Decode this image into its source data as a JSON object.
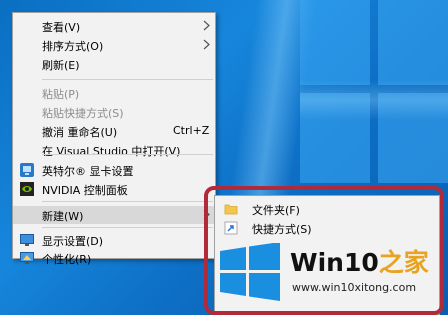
{
  "context_menu": {
    "items": [
      {
        "label": "查看(V)"
      },
      {
        "label": "排序方式(O)"
      },
      {
        "label": "刷新(E)"
      },
      {
        "label": "粘贴(P)"
      },
      {
        "label": "粘贴快捷方式(S)"
      },
      {
        "label": "撤消 重命名(U)",
        "shortcut": "Ctrl+Z"
      },
      {
        "label": "在 Visual Studio 中打开(V)"
      },
      {
        "label": "英特尔® 显卡设置"
      },
      {
        "label": "NVIDIA 控制面板"
      },
      {
        "label": "新建(W)"
      },
      {
        "label": "显示设置(D)"
      },
      {
        "label": "个性化(R)"
      }
    ]
  },
  "submenu": {
    "items": [
      {
        "label": "文件夹(F)"
      },
      {
        "label": "快捷方式(S)"
      }
    ]
  },
  "watermark": {
    "title_main": "Win10",
    "title_accent": "之家",
    "url": "www.win10xitong.com"
  },
  "colors": {
    "desktop": "#1686dc",
    "menu_bg": "#f2f2f2",
    "highlight_frame": "#b02a3a",
    "watermark_accent": "#e8a320",
    "win_logo": "#1a8fe0"
  }
}
